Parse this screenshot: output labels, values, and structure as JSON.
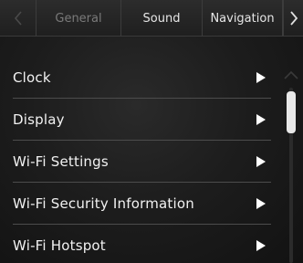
{
  "tabs": [
    {
      "label": "General",
      "state": "inactive"
    },
    {
      "label": "Sound",
      "state": "active"
    },
    {
      "label": "Navigation",
      "state": "active"
    }
  ],
  "icons": {
    "tab_prev": "chevron-left-icon",
    "tab_next": "chevron-right-icon",
    "row_arrow": "play-triangle-icon",
    "scroll_up": "chevron-up-icon"
  },
  "menu": {
    "items": [
      {
        "label": "Clock"
      },
      {
        "label": "Display"
      },
      {
        "label": "Wi-Fi Settings"
      },
      {
        "label": "Wi-Fi Security Information"
      },
      {
        "label": "Wi-Fi Hotspot"
      }
    ]
  },
  "colors": {
    "text": "#f2f2f2",
    "inactive_tab": "#7a7a7a",
    "divider": "#4c4c4c",
    "scroll_thumb": "#e8e8e8"
  }
}
